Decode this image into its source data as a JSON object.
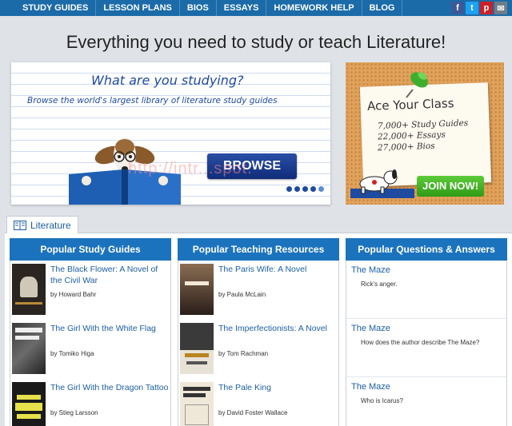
{
  "nav": {
    "items": [
      "STUDY GUIDES",
      "LESSON PLANS",
      "BIOS",
      "ESSAYS",
      "HOMEWORK HELP",
      "BLOG"
    ],
    "social": [
      {
        "icon": "facebook-icon",
        "glyph": "f",
        "color": "#3b5998"
      },
      {
        "icon": "twitter-icon",
        "glyph": "t",
        "color": "#1da1f2"
      },
      {
        "icon": "pinterest-icon",
        "glyph": "p",
        "color": "#cb2027"
      },
      {
        "icon": "email-icon",
        "glyph": "✉",
        "color": "#6f7c89"
      }
    ]
  },
  "headline": "Everything you need to study or teach Literature!",
  "hero": {
    "title": "What are you studying?",
    "subtitle": "Browse the world's largest library of literature study guides",
    "button": "BROWSE NOW",
    "slide_count": 5,
    "active_slide": 5
  },
  "ad": {
    "title": "Ace Your Class",
    "lines": [
      "7,000+ Study Guides",
      "22,000+ Essays",
      "27,000+ Bios"
    ],
    "button": "JOIN NOW!"
  },
  "watermark": "http://intr...spot.",
  "tab": {
    "label": "Literature",
    "icon": "book-icon"
  },
  "columns": {
    "study_guides": {
      "header": "Popular Study Guides",
      "books": [
        {
          "title": "The Black Flower: A Novel of the Civil War",
          "author": "by Howard Bahr"
        },
        {
          "title": "The Girl With the White Flag",
          "author": "by Tomiko Higa"
        },
        {
          "title": "The Girl With the Dragon Tattoo",
          "author": "by Stieg Larsson"
        }
      ]
    },
    "teaching": {
      "header": "Popular Teaching Resources",
      "books": [
        {
          "title": "The Paris Wife: A Novel",
          "author": "by Paula McLain"
        },
        {
          "title": "The Imperfectionists: A Novel",
          "author": "by Tom Rachman"
        },
        {
          "title": "The Pale King",
          "author": "by David Foster Wallace"
        }
      ]
    },
    "qa": {
      "header": "Popular Questions & Answers",
      "items": [
        {
          "title": "The Maze",
          "question": "Rick's anger."
        },
        {
          "title": "The Maze",
          "question": "How does the author describe The Maze?"
        },
        {
          "title": "The Maze",
          "question": "Who is Icarus?"
        }
      ]
    }
  }
}
